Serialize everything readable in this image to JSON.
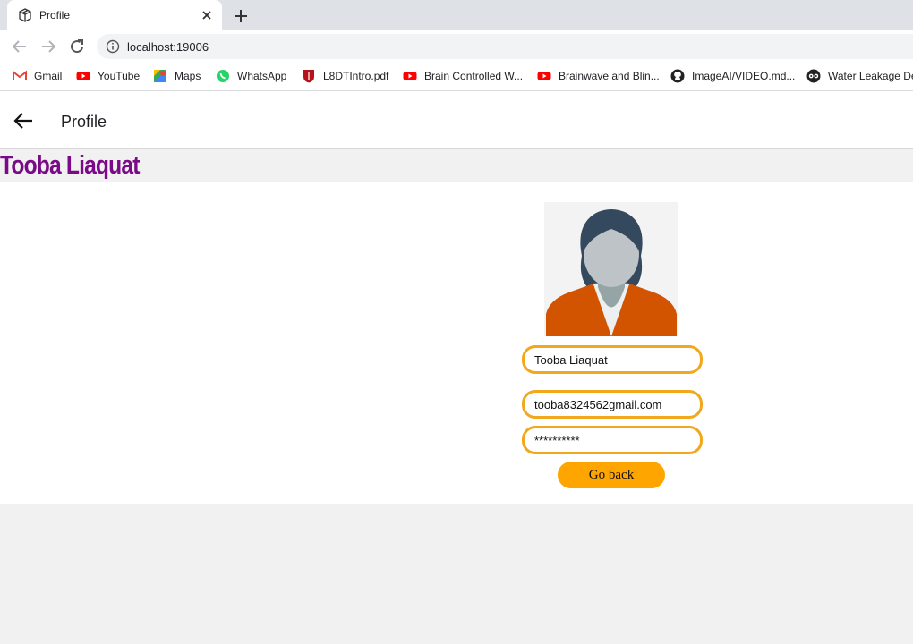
{
  "browser": {
    "tab_title": "Profile",
    "url": "localhost:19006",
    "bookmarks": [
      {
        "label": "Gmail",
        "icon": "gmail-icon"
      },
      {
        "label": "YouTube",
        "icon": "youtube-icon"
      },
      {
        "label": "Maps",
        "icon": "maps-icon"
      },
      {
        "label": "WhatsApp",
        "icon": "whatsapp-icon"
      },
      {
        "label": "L8DTIntro.pdf",
        "icon": "pdf-icon"
      },
      {
        "label": "Brain Controlled W...",
        "icon": "youtube-icon"
      },
      {
        "label": "Brainwave and Blin...",
        "icon": "youtube-icon"
      },
      {
        "label": "ImageAI/VIDEO.md...",
        "icon": "github-icon"
      },
      {
        "label": "Water Leakage De",
        "icon": "owl-icon"
      }
    ]
  },
  "appbar": {
    "title": "Profile"
  },
  "profile": {
    "heading": "Tooba Liaquat",
    "name_value": "Tooba Liaquat",
    "email_value": "tooba8324562gmail.com",
    "password_value": "**********",
    "back_button_label": "Go back"
  },
  "colors": {
    "heading": "#7a0a87",
    "field_border": "#f2a81d",
    "button": "#ffa500"
  }
}
